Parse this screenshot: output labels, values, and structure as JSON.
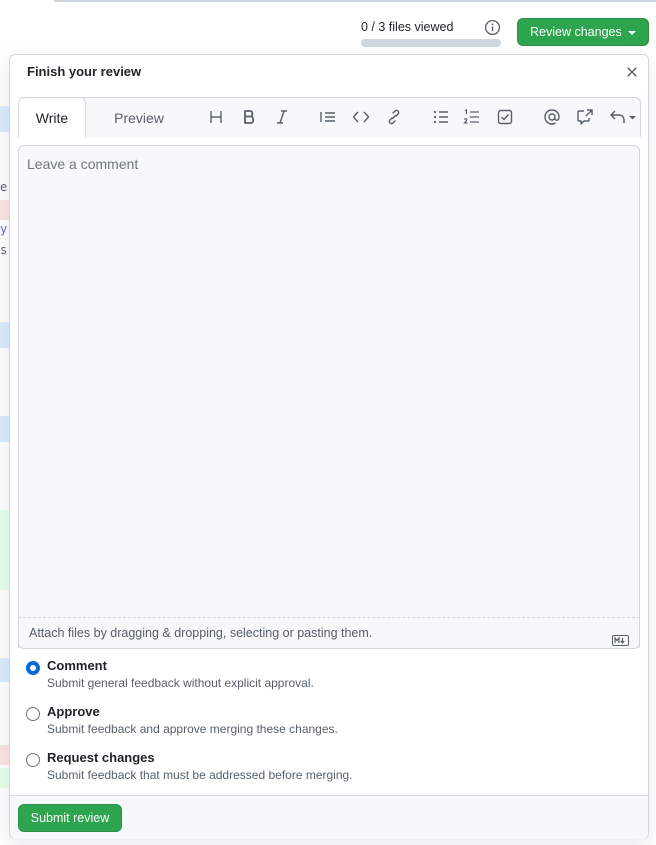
{
  "header": {
    "files_viewed": "0 / 3 files viewed",
    "files_viewed_fraction": 0,
    "review_button_label": "Review changes"
  },
  "dialog": {
    "title": "Finish your review",
    "tabs": {
      "write": "Write",
      "preview": "Preview"
    },
    "toolbar_icons": [
      "heading-icon",
      "bold-icon",
      "italic-icon",
      "quote-icon",
      "code-icon",
      "link-icon",
      "unordered-list-icon",
      "ordered-list-icon",
      "task-list-icon",
      "mention-icon",
      "cross-reference-icon",
      "undo-icon"
    ],
    "comment_placeholder": "Leave a comment",
    "attach_text": "Attach files by dragging & dropping, selecting or pasting them.",
    "options": [
      {
        "label": "Comment",
        "description": "Submit general feedback without explicit approval.",
        "checked": true
      },
      {
        "label": "Approve",
        "description": "Submit feedback and approve merging these changes.",
        "checked": false
      },
      {
        "label": "Request changes",
        "description": "Submit feedback that must be addressed before merging.",
        "checked": false
      }
    ],
    "submit_label": "Submit review"
  },
  "background": {
    "fragments": [
      "er",
      "y",
      "s"
    ]
  },
  "colors": {
    "primary_green": "#2da44e",
    "accent_blue": "#0969da",
    "border": "#d0d7de",
    "muted_text": "#57606a"
  }
}
